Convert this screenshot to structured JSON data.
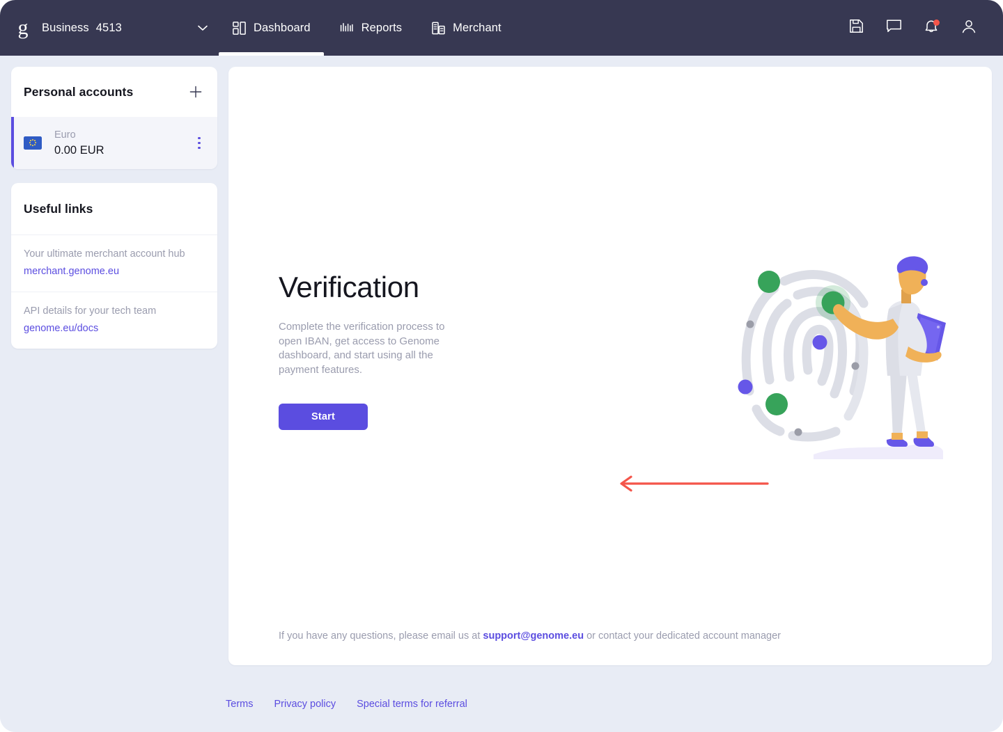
{
  "header": {
    "logo_icon": "genome-g-logo",
    "brand_name": "Business",
    "brand_id": "4513",
    "caret_icon": "chevron-down-icon",
    "nav": [
      {
        "label": "Dashboard",
        "icon": "dashboard-grid-icon",
        "active": true
      },
      {
        "label": "Reports",
        "icon": "bar-chart-icon",
        "active": false
      },
      {
        "label": "Merchant",
        "icon": "building-list-icon",
        "active": false
      }
    ],
    "actions": [
      {
        "name": "save-icon",
        "badge": false
      },
      {
        "name": "chat-bubble-icon",
        "badge": false
      },
      {
        "name": "notifications-bell-icon",
        "badge": true
      },
      {
        "name": "user-profile-icon",
        "badge": false
      }
    ]
  },
  "sidebar": {
    "accounts": {
      "title": "Personal accounts",
      "add_icon": "plus-icon",
      "items": [
        {
          "flag": "eu-flag-icon",
          "currency_name": "Euro",
          "balance": "0.00 EUR",
          "menu_icon": "kebab-menu-icon",
          "selected": true
        }
      ]
    },
    "useful_links": {
      "title": "Useful links",
      "items": [
        {
          "description": "Your ultimate merchant account hub",
          "url": "merchant.genome.eu"
        },
        {
          "description": "API details for your tech team",
          "url": "genome.eu/docs"
        }
      ]
    }
  },
  "main": {
    "title": "Verification",
    "description": "Complete the verification process to open IBAN, get access to Genome dashboard, and start using all the payment features.",
    "start_button": "Start",
    "annotation_arrow": "red-left-arrow-annotation",
    "illustration": "fingerprint-verification-illustration",
    "support": {
      "prefix": "If you have any questions, please email us at ",
      "email": "support@genome.eu",
      "suffix": " or contact your dedicated account manager"
    }
  },
  "footer": {
    "links": [
      {
        "label": "Terms"
      },
      {
        "label": "Privacy policy"
      },
      {
        "label": "Special terms for referral"
      }
    ]
  },
  "colors": {
    "header_bg": "#373852",
    "page_bg": "#e8ecf5",
    "accent": "#5b4de0",
    "annotation": "#f4554a",
    "muted_text": "#9a9cae",
    "dark_text": "#15161f"
  }
}
